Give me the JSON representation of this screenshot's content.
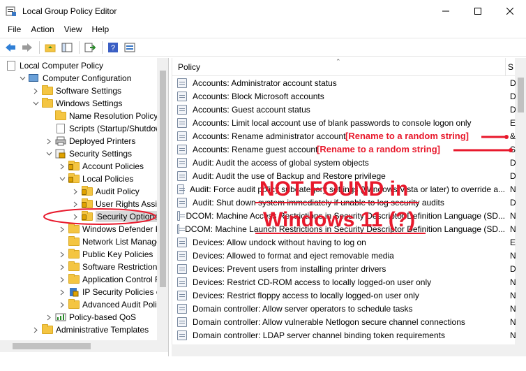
{
  "window": {
    "title": "Local Group Policy Editor"
  },
  "menu": [
    "File",
    "Action",
    "View",
    "Help"
  ],
  "tree": [
    {
      "label": "Local Computer Policy",
      "icon": "doc-icon",
      "level": 0,
      "expander": ""
    },
    {
      "label": "Computer Configuration",
      "icon": "computer-icon",
      "level": 1,
      "expander": "v"
    },
    {
      "label": "Software Settings",
      "icon": "folder-icon",
      "level": 2,
      "expander": ">"
    },
    {
      "label": "Windows Settings",
      "icon": "folder-icon",
      "level": 2,
      "expander": "v"
    },
    {
      "label": "Name Resolution Policy",
      "icon": "folder-icon",
      "level": 3,
      "expander": ""
    },
    {
      "label": "Scripts (Startup/Shutdown)",
      "icon": "doc-icon",
      "level": 3,
      "expander": ""
    },
    {
      "label": "Deployed Printers",
      "icon": "printer-icon",
      "level": 3,
      "expander": ">"
    },
    {
      "label": "Security Settings",
      "icon": "security-icon",
      "level": 3,
      "expander": "v"
    },
    {
      "label": "Account Policies",
      "icon": "folder-lock-icon",
      "level": 4,
      "expander": ">"
    },
    {
      "label": "Local Policies",
      "icon": "folder-lock-icon",
      "level": 4,
      "expander": "v"
    },
    {
      "label": "Audit Policy",
      "icon": "folder-lock-icon",
      "level": 5,
      "expander": ">"
    },
    {
      "label": "User Rights Assignment",
      "icon": "folder-lock-icon",
      "level": 5,
      "expander": ">"
    },
    {
      "label": "Security Options",
      "icon": "folder-lock-icon",
      "level": 5,
      "expander": ">",
      "selected": true
    },
    {
      "label": "Windows Defender Firewall",
      "icon": "folder-icon",
      "level": 4,
      "expander": ">"
    },
    {
      "label": "Network List Manager",
      "icon": "folder-icon",
      "level": 4,
      "expander": ""
    },
    {
      "label": "Public Key Policies",
      "icon": "folder-icon",
      "level": 4,
      "expander": ">"
    },
    {
      "label": "Software Restriction Policies",
      "icon": "folder-icon",
      "level": 4,
      "expander": ">"
    },
    {
      "label": "Application Control Policies",
      "icon": "folder-icon",
      "level": 4,
      "expander": ">"
    },
    {
      "label": "IP Security Policies on Local Computer",
      "icon": "ip-security-icon",
      "level": 4,
      "expander": ">"
    },
    {
      "label": "Advanced Audit Policy",
      "icon": "folder-icon",
      "level": 4,
      "expander": ">"
    },
    {
      "label": "Policy-based QoS",
      "icon": "qos-icon",
      "level": 3,
      "expander": ">"
    },
    {
      "label": "Administrative Templates",
      "icon": "folder-icon",
      "level": 2,
      "expander": ">"
    }
  ],
  "list_header": {
    "policy": "Policy",
    "setting": "S"
  },
  "policies": [
    {
      "name": "Accounts: Administrator account status",
      "setting": "D"
    },
    {
      "name": "Accounts: Block Microsoft accounts",
      "setting": "D"
    },
    {
      "name": "Accounts: Guest account status",
      "setting": "D"
    },
    {
      "name": "Accounts: Limit local account use of blank passwords to console logon only",
      "setting": "E"
    },
    {
      "name": "Accounts: Rename administrator account",
      "setting": "&"
    },
    {
      "name": "Accounts: Rename guest account",
      "setting": "S"
    },
    {
      "name": "Audit: Audit the access of global system objects",
      "setting": "D"
    },
    {
      "name": "Audit: Audit the use of Backup and Restore privilege",
      "setting": "D"
    },
    {
      "name": "Audit: Force audit policy subcategory settings (Windows Vista or later) to override a...",
      "setting": "N"
    },
    {
      "name": "Audit: Shut down system immediately if unable to log security audits",
      "setting": "D"
    },
    {
      "name": "DCOM: Machine Access Restrictions in Security Descriptor Definition Language (SD...",
      "setting": "N"
    },
    {
      "name": "DCOM: Machine Launch Restrictions in Security Descriptor Definition Language (SD...",
      "setting": "N"
    },
    {
      "name": "Devices: Allow undock without having to log on",
      "setting": "E"
    },
    {
      "name": "Devices: Allowed to format and eject removable media",
      "setting": "N"
    },
    {
      "name": "Devices: Prevent users from installing printer drivers",
      "setting": "D"
    },
    {
      "name": "Devices: Restrict CD-ROM access to locally logged-on user only",
      "setting": "N"
    },
    {
      "name": "Devices: Restrict floppy access to locally logged-on user only",
      "setting": "N"
    },
    {
      "name": "Domain controller: Allow server operators to schedule tasks",
      "setting": "N"
    },
    {
      "name": "Domain controller: Allow vulnerable Netlogon secure channel connections",
      "setting": "N"
    },
    {
      "name": "Domain controller: LDAP server channel binding token requirements",
      "setting": "N"
    }
  ],
  "annotations": {
    "rename_admin": "[Rename to a random string]",
    "rename_guest": "[Rename to a random string]",
    "not_found_line1": "NOT FOUND in",
    "not_found_line2": "Windows 11 (?)"
  },
  "colors": {
    "annotation": "#e8192c",
    "folder": "#f4c542"
  }
}
